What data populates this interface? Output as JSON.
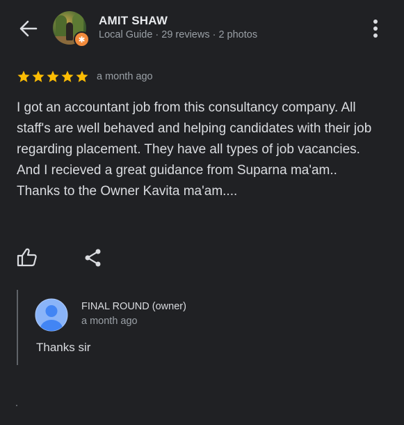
{
  "reviewer": {
    "name": "AMIT SHAW",
    "meta": "Local Guide · 29 reviews · 2 photos"
  },
  "review": {
    "rating": 5,
    "max_rating": 5,
    "date": "a month ago",
    "text": "I got an accountant job from this consultancy company. All staff's are well behaved and helping candidates with their job regarding placement. They have all types of job vacancies.\nAnd I recieved a great guidance from Suparna ma'am..\nThanks to the Owner Kavita ma'am...."
  },
  "owner_reply": {
    "name": "FINAL ROUND (owner)",
    "date": "a month ago",
    "text": "Thanks sir"
  },
  "colors": {
    "background": "#202124",
    "star": "#fbbc04",
    "badge": "#f28b3c",
    "owner_avatar": "#8ab4f8"
  },
  "icons": {
    "back": "arrow-left",
    "more": "vertical-dots",
    "like": "thumbs-up-outline",
    "share": "share-nodes",
    "badge": "local-guide-star"
  }
}
